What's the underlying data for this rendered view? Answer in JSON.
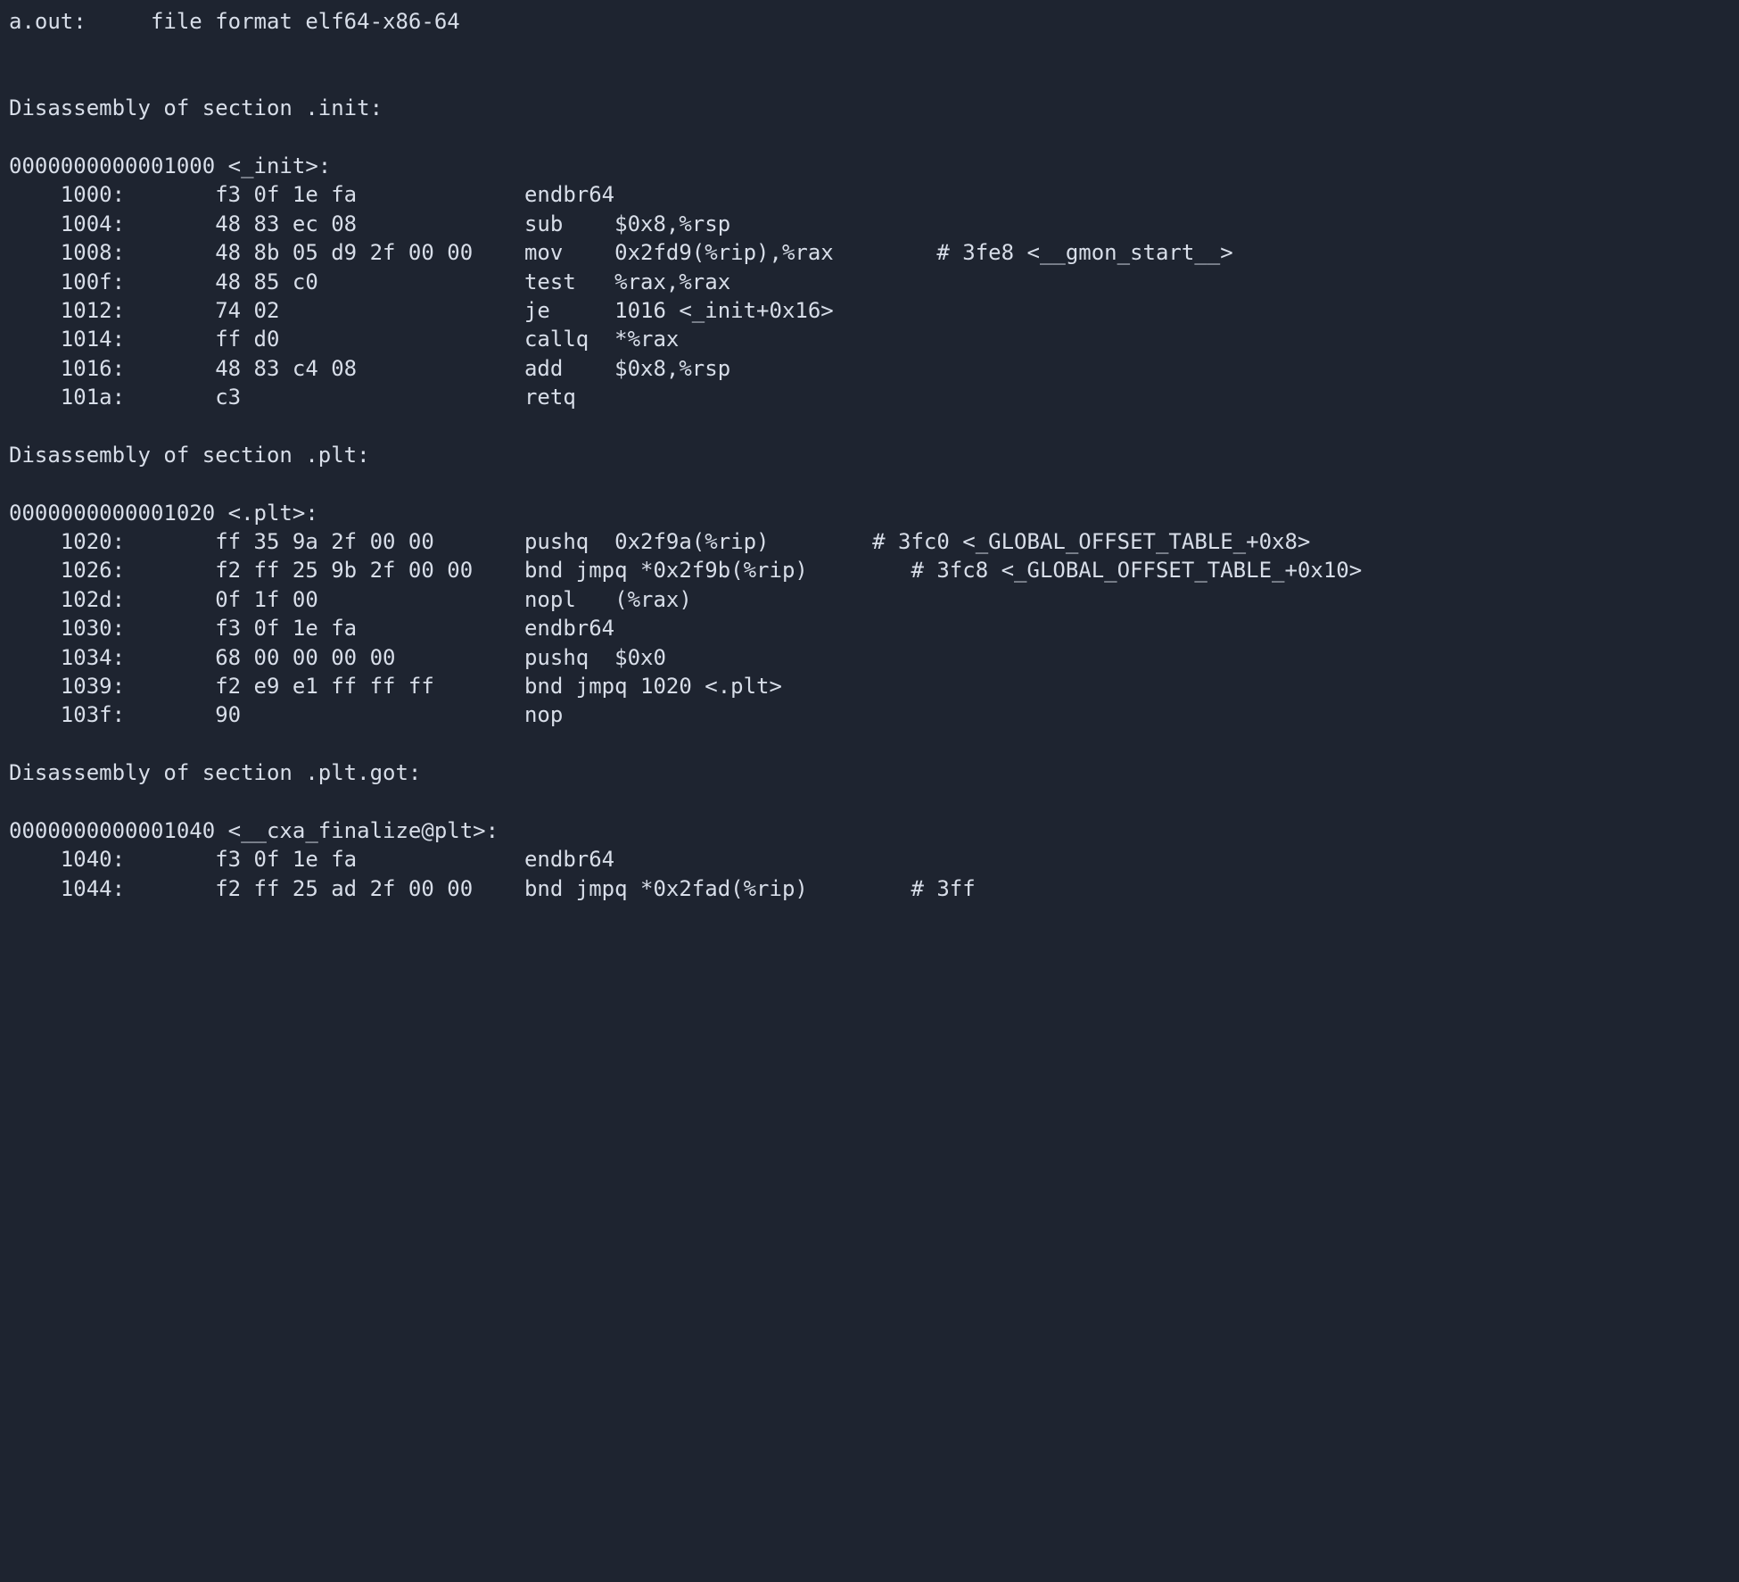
{
  "terminal": {
    "header": "a.out:     file format elf64-x86-64",
    "sections": [
      {
        "title": "Disassembly of section .init:",
        "symbol": "0000000000001000 <_init>:",
        "lines": [
          "    1000:       f3 0f 1e fa             endbr64 ",
          "    1004:       48 83 ec 08             sub    $0x8,%rsp",
          "    1008:       48 8b 05 d9 2f 00 00    mov    0x2fd9(%rip),%rax        # 3fe8 <__gmon_start__>",
          "    100f:       48 85 c0                test   %rax,%rax",
          "    1012:       74 02                   je     1016 <_init+0x16>",
          "    1014:       ff d0                   callq  *%rax",
          "    1016:       48 83 c4 08             add    $0x8,%rsp",
          "    101a:       c3                      retq   "
        ]
      },
      {
        "title": "Disassembly of section .plt:",
        "symbol": "0000000000001020 <.plt>:",
        "lines": [
          "    1020:       ff 35 9a 2f 00 00       pushq  0x2f9a(%rip)        # 3fc0 <_GLOBAL_OFFSET_TABLE_+0x8>",
          "    1026:       f2 ff 25 9b 2f 00 00    bnd jmpq *0x2f9b(%rip)        # 3fc8 <_GLOBAL_OFFSET_TABLE_+0x10>",
          "    102d:       0f 1f 00                nopl   (%rax)",
          "    1030:       f3 0f 1e fa             endbr64 ",
          "    1034:       68 00 00 00 00          pushq  $0x0",
          "    1039:       f2 e9 e1 ff ff ff       bnd jmpq 1020 <.plt>",
          "    103f:       90                      nop"
        ]
      },
      {
        "title": "Disassembly of section .plt.got:",
        "symbol": "0000000000001040 <__cxa_finalize@plt>:",
        "lines": [
          "    1040:       f3 0f 1e fa             endbr64 ",
          "    1044:       f2 ff 25 ad 2f 00 00    bnd jmpq *0x2fad(%rip)        # 3ff"
        ]
      }
    ]
  }
}
